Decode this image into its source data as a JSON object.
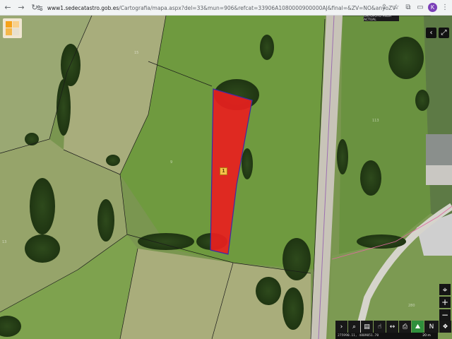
{
  "browser": {
    "url_domain": "www1.sedecatastro.gob.es",
    "url_path": "/Cartografia/mapa.aspx?del=33&mun=906&refcat=33906A1080000900000AJ&final=&ZV=NO&anyoZV=",
    "profile_initial": "K"
  },
  "map": {
    "top_right_label": "ORTOFOTO PNOA ACTUAL",
    "parcel_marker": "1",
    "parcel_color": "#e8201e",
    "plot_numbers": [
      "13",
      "9",
      "113",
      "280",
      "15"
    ]
  },
  "toolbar": {
    "coordinates": "275990.11, 4809051.70",
    "scale": "20 m"
  },
  "zoom": {
    "locate_symbol": "⌖",
    "in_symbol": "+",
    "out_symbol": "−"
  }
}
